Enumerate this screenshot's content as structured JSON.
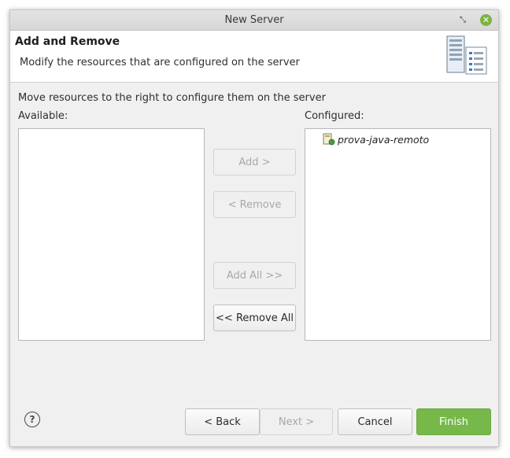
{
  "window": {
    "title": "New Server",
    "restore_icon": "restore-icon",
    "close_icon": "close-icon"
  },
  "header": {
    "title": "Add and Remove",
    "description": "Modify the resources that are configured on the server",
    "icon": "server-icon"
  },
  "body": {
    "instructions": "Move resources to the right to configure them on the server",
    "available_label": "Available:",
    "configured_label": "Configured:",
    "available_items": [],
    "configured_items": [
      {
        "label": "prova-java-remoto",
        "icon": "project-icon"
      }
    ]
  },
  "actions": {
    "add": "Add >",
    "remove": "< Remove",
    "add_all": "Add All >>",
    "remove_all": "<< Remove All"
  },
  "footer": {
    "help_icon": "help-icon",
    "back": "< Back",
    "next": "Next >",
    "cancel": "Cancel",
    "finish": "Finish"
  },
  "colors": {
    "accent": "#76b84a",
    "dialog_bg": "#f0f0f0"
  }
}
